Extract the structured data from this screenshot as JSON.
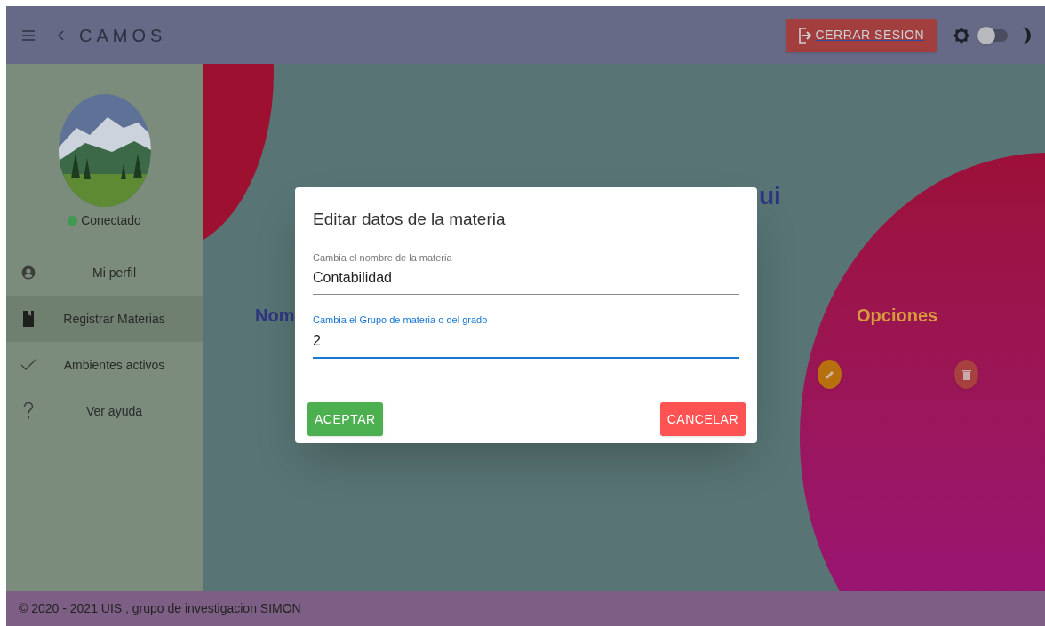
{
  "app_bar": {
    "title": "CAMOS",
    "logout_button": "CERRAR SESION",
    "dark_mode": false
  },
  "sidebar": {
    "status": "Conectado",
    "online": true,
    "items": [
      {
        "label": "Mi perfil",
        "kind": "account",
        "selected": false
      },
      {
        "label": "Registrar Materias",
        "kind": "book",
        "selected": true
      },
      {
        "label": "Ambientes activos",
        "kind": "check",
        "selected": false
      },
      {
        "label": "Ver ayuda",
        "kind": "help",
        "selected": false
      }
    ]
  },
  "background": {
    "heading_visible_part": "ui",
    "column_visible_part": "Nom",
    "options_header": "Opciones"
  },
  "dialog": {
    "title": "Editar datos de la materia",
    "fields": [
      {
        "label": "Cambia el nombre de la materia",
        "value": "Contabilidad",
        "focused": false
      },
      {
        "label": "Cambia el Grupo de materia o del grado",
        "value": "2",
        "focused": true
      }
    ],
    "accept": "ACEPTAR",
    "cancel": "CANCELAR"
  },
  "footer": "© 2020 - 2021 UIS , grupo de investigacion SIMON"
}
